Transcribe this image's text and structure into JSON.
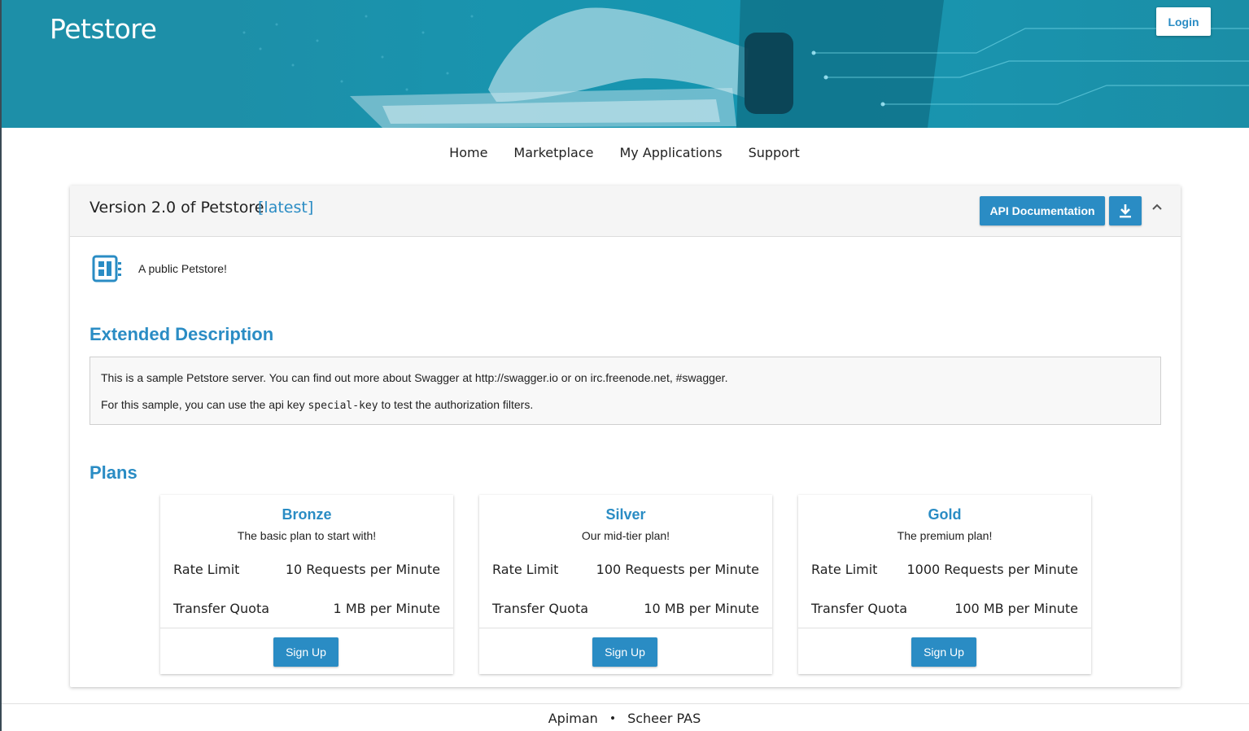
{
  "header": {
    "brand": "Petstore",
    "login_label": "Login"
  },
  "nav": {
    "items": [
      "Home",
      "Marketplace",
      "My Applications",
      "Support"
    ]
  },
  "api": {
    "version_title": "Version 2.0 of Petstore",
    "version_tag": "[latest]",
    "api_doc_label": "API Documentation",
    "short_description": "A public Petstore!",
    "extended_title": "Extended Description",
    "extended_line1_prefix": "This is a sample Petstore server. You can find out more about Swagger at ",
    "extended_link1": "http://swagger.io",
    "extended_line1_mid": " or on ",
    "extended_link2": "irc.freenode.net, #swagger",
    "extended_line1_suffix": ".",
    "extended_line2_prefix": "For this sample, you can use the api key ",
    "extended_code": "special-key",
    "extended_line2_suffix": " to test the authorization filters.",
    "plans_title": "Plans"
  },
  "plans": [
    {
      "name": "Bronze",
      "description": "The basic plan to start with!",
      "rate_label": "Rate Limit",
      "rate_value": "10 Requests per Minute",
      "quota_label": "Transfer Quota",
      "quota_value": "1 MB per Minute",
      "signup_label": "Sign Up"
    },
    {
      "name": "Silver",
      "description": "Our mid-tier plan!",
      "rate_label": "Rate Limit",
      "rate_value": "100 Requests per Minute",
      "quota_label": "Transfer Quota",
      "quota_value": "10 MB per Minute",
      "signup_label": "Sign Up"
    },
    {
      "name": "Gold",
      "description": "The premium plan!",
      "rate_label": "Rate Limit",
      "rate_value": "1000 Requests per Minute",
      "quota_label": "Transfer Quota",
      "quota_value": "100 MB per Minute",
      "signup_label": "Sign Up"
    }
  ],
  "footer": {
    "left": "Apiman",
    "separator": "•",
    "right": "Scheer PAS"
  },
  "icons": {
    "download": "download-icon",
    "collapse": "chevron-up-icon",
    "api": "api-icon"
  },
  "colors": {
    "accent": "#2a8cc4",
    "hero": "#1d8fa8"
  }
}
